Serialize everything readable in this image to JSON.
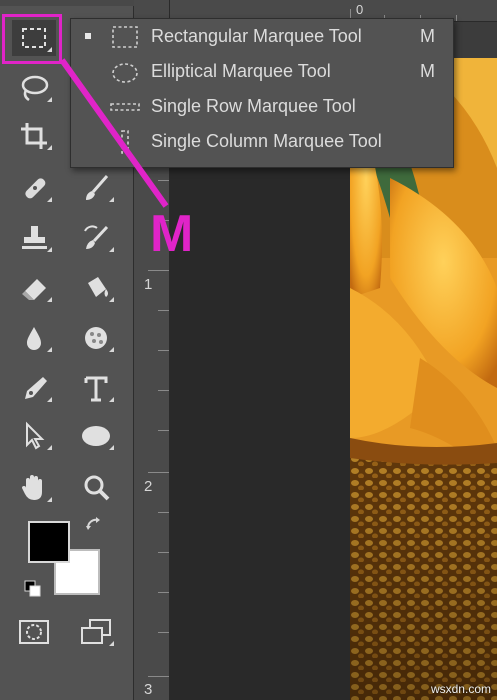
{
  "flyout": {
    "items": [
      {
        "label": "Rectangular Marquee Tool",
        "shortcut": "M",
        "selected": true,
        "icon": "rectangular-marquee-icon"
      },
      {
        "label": "Elliptical Marquee Tool",
        "shortcut": "M",
        "selected": false,
        "icon": "elliptical-marquee-icon"
      },
      {
        "label": "Single Row Marquee Tool",
        "shortcut": "",
        "selected": false,
        "icon": "single-row-marquee-icon"
      },
      {
        "label": "Single Column Marquee Tool",
        "shortcut": "",
        "selected": false,
        "icon": "single-column-marquee-icon"
      }
    ]
  },
  "annotation": {
    "label": "M",
    "color": "#e024c8"
  },
  "ruler": {
    "numbers": [
      "1",
      "2",
      "3"
    ],
    "top_number": "0"
  },
  "swatches": {
    "foreground": "#000000",
    "background": "#ffffff"
  },
  "watermark": "wsxdn.com",
  "colors": {
    "panel": "#535353",
    "highlight": "#e024c8",
    "menu_text": "#dcdcdc"
  }
}
